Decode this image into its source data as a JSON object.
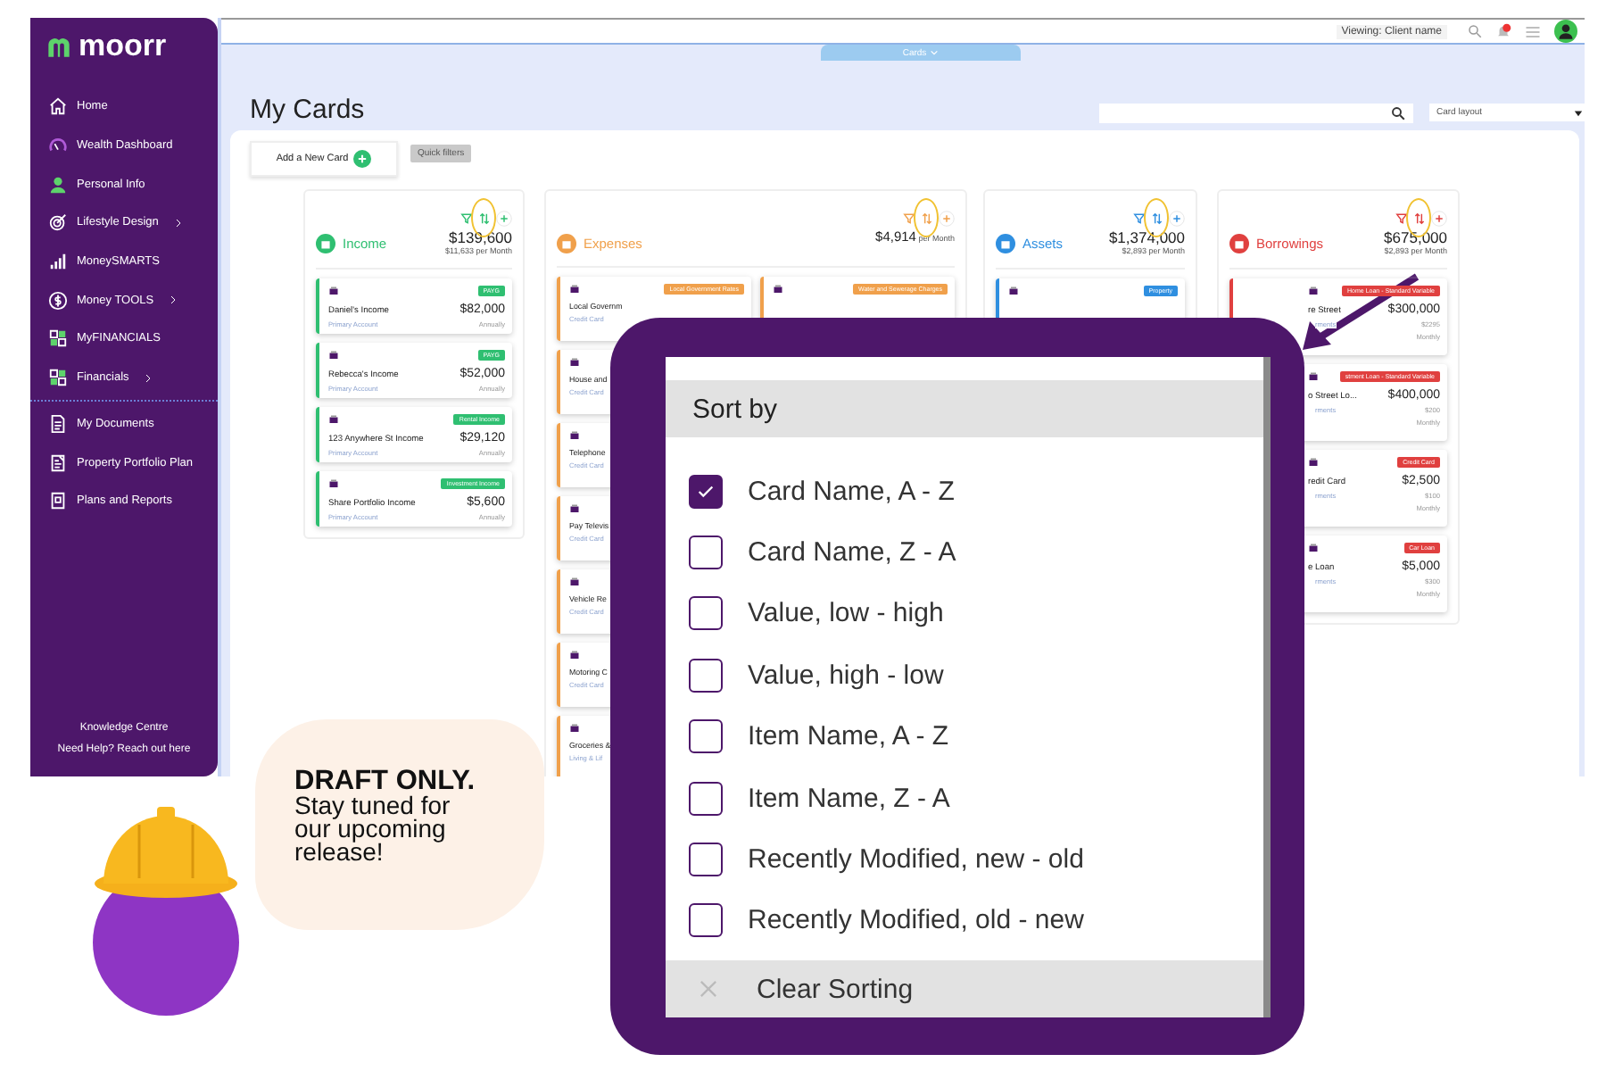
{
  "sidebar": {
    "brand": "moorr",
    "items": [
      {
        "label": "Home",
        "has_submenu": false
      },
      {
        "label": "Wealth Dashboard",
        "has_submenu": false
      },
      {
        "label": "Personal Info",
        "has_submenu": false
      },
      {
        "label": "Lifestyle Design",
        "has_submenu": true
      },
      {
        "label": "MoneySMARTS",
        "has_submenu": false
      },
      {
        "label": "Money TOOLS",
        "has_submenu": true
      },
      {
        "label": "MyFINANCIALS",
        "has_submenu": false
      },
      {
        "label": "Financials",
        "has_submenu": true
      },
      {
        "label": "My Documents",
        "has_submenu": false
      },
      {
        "label": "Property Portfolio Plan",
        "has_submenu": false
      },
      {
        "label": "Plans and Reports",
        "has_submenu": false
      }
    ],
    "footer": [
      "Knowledge Centre",
      "Need Help? Reach out here"
    ]
  },
  "top_bar": {
    "viewing": "Viewing: Client name",
    "tab": "Cards"
  },
  "page": {
    "title": "My Cards",
    "layout_select": "Card layout",
    "add_button": "Add a New Card",
    "quick_filters": "Quick filters"
  },
  "columns": [
    {
      "title": "Income",
      "color": "#2fbf71",
      "total": "$139,600",
      "per_month": "$11,633 per Month",
      "lanes": [
        [
          {
            "name": "Daniel's Income",
            "amount": "$82,000",
            "badge": "PAYG",
            "account": "Primary Account",
            "frequency": "Annually"
          },
          {
            "name": "Rebecca's Income",
            "amount": "$52,000",
            "badge": "PAYG",
            "account": "Primary Account",
            "frequency": "Annually"
          },
          {
            "name": "123 Anywhere St Income",
            "amount": "$29,120",
            "badge": "Rental Income",
            "account": "Primary Account",
            "frequency": "Annually"
          },
          {
            "name": "Share Portfolio Income",
            "amount": "$5,600",
            "badge": "Investment Income",
            "account": "Primary Account",
            "frequency": "Annually"
          }
        ]
      ]
    },
    {
      "title": "Expenses",
      "color": "#f0a04b",
      "per_month": "**$4,914** per Month",
      "lanes": [
        [
          {
            "name": "Local Governm",
            "badge": "Local Government Rates",
            "account": "Credit Card"
          },
          {
            "name": "House and",
            "account": "Credit Card"
          },
          {
            "name": "Telephone",
            "account": "Credit Card"
          },
          {
            "name": "Pay Televis",
            "account": "Credit Card"
          },
          {
            "name": "Vehicle Re",
            "account": "Credit Card"
          },
          {
            "name": "Motoring C",
            "account": "Credit Card"
          },
          {
            "name": "Groceries &",
            "account": "Living & Lif"
          }
        ],
        [
          {
            "badge": "Water and Sewerage Charges"
          }
        ]
      ]
    },
    {
      "title": "Assets",
      "color": "#2f8fe0",
      "total": "$1,374,000",
      "per_month": "$2,893 per Month",
      "lanes": [
        [
          {
            "badge": "Property"
          }
        ]
      ]
    },
    {
      "title": "Borrowings",
      "color": "#e0403f",
      "total": "$675,000",
      "per_month": "$2,893 per Month",
      "lanes": [
        [
          {
            "name": "re Street",
            "amount": "$300,000",
            "badge": "Home Loan - Standard Variable",
            "account": "rments",
            "sub_value": "$2295",
            "frequency": "Monthly"
          },
          {
            "name": "o Street Lo...",
            "amount": "$400,000",
            "badge": "stment Loan - Standard Variable",
            "account": "rments",
            "sub_value": "$200",
            "frequency": "Monthly"
          },
          {
            "name": "redit Card",
            "amount": "$2,500",
            "badge": "Credit Card",
            "account": "rments",
            "sub_value": "$100",
            "frequency": "Monthly"
          },
          {
            "name": "e Loan",
            "amount": "$5,000",
            "badge": "Car Loan",
            "account": "rments",
            "sub_value": "$300",
            "frequency": "Monthly"
          }
        ]
      ]
    }
  ],
  "sort_menu": {
    "title": "Sort by",
    "options": [
      {
        "label": "Card Name, A - Z",
        "checked": true
      },
      {
        "label": "Card Name, Z - A",
        "checked": false
      },
      {
        "label": "Value, low - high",
        "checked": false
      },
      {
        "label": "Value, high - low",
        "checked": false
      },
      {
        "label": "Item Name, A - Z",
        "checked": false
      },
      {
        "label": "Item Name, Z - A",
        "checked": false
      },
      {
        "label": "Recently Modified, new - old",
        "checked": false
      },
      {
        "label": "Recently Modified, old - new",
        "checked": false
      }
    ],
    "clear": "Clear Sorting"
  },
  "notice": {
    "heading": "DRAFT ONLY.",
    "text": "Stay tuned for our upcoming release!"
  }
}
